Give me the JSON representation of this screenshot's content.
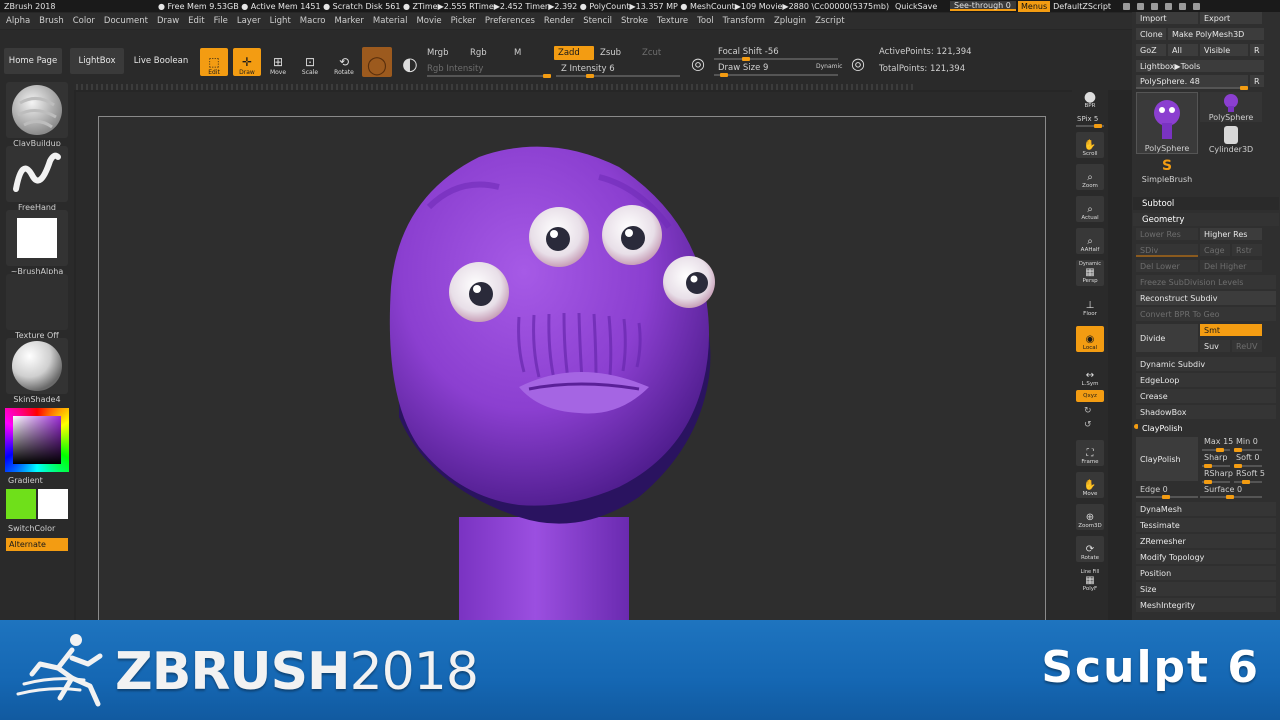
{
  "titlebar": {
    "app": "ZBrush 2018",
    "stats": "● Free Mem 9.53GB ● Active Mem 1451 ● Scratch Disk 561 ● ZTime▶2.555 RTime▶2.452 Timer▶2.392 ● PolyCount▶13.357 MP ● MeshCount▶109 Movie▶2880 \\Cc00000(5375mb)",
    "quicksave": "QuickSave",
    "see_through": "See-through 0",
    "menus": "Menus",
    "default_script": "DefaultZScript"
  },
  "menubar": [
    "Alpha",
    "Brush",
    "Color",
    "Document",
    "Draw",
    "Edit",
    "File",
    "Layer",
    "Light",
    "Macro",
    "Marker",
    "Material",
    "Movie",
    "Picker",
    "Preferences",
    "Render",
    "Stencil",
    "Stroke",
    "Texture",
    "Tool",
    "Transform",
    "Zplugin",
    "Zscript"
  ],
  "shelf": {
    "home_page": "Home Page",
    "lightbox": "LightBox",
    "live_boolean": "Live Boolean",
    "edit": "Edit",
    "draw": "Draw",
    "move": "Move",
    "scale": "Scale",
    "rotate": "Rotate",
    "mrgb": "Mrgb",
    "rgb": "Rgb",
    "m": "M",
    "rgb_intensity": "Rgb Intensity",
    "zadd": "Zadd",
    "zsub": "Zsub",
    "zcut": "Zcut",
    "z_intensity": "Z Intensity 6",
    "z_intensity_value": 6,
    "focal_shift": "Focal Shift -56",
    "draw_size": "Draw Size 9",
    "dynamic": "Dynamic",
    "active_points": "ActivePoints: 121,394",
    "total_points": "TotalPoints: 121,394"
  },
  "lefttray": {
    "brush": "ClayBuildup",
    "stroke": "FreeHand",
    "alpha": "~BrushAlpha",
    "texture": "Texture Off",
    "material": "SkinShade4",
    "gradient": "Gradient",
    "switch_color": "SwitchColor",
    "alternate": "Alternate"
  },
  "rcol": {
    "bpr": "BPR",
    "spix": "SPix 5",
    "scroll": "Scroll",
    "zoom": "Zoom",
    "actual": "Actual",
    "aahalf": "AAHalf",
    "dynamic": "Dynamic",
    "persp": "Persp",
    "floor": "Floor",
    "local": "Local",
    "lsym": "L.Sym",
    "xyz": "Qxyz",
    "frame": "Frame",
    "move": "Move",
    "zoom3d": "Zoom3D",
    "rotate": "Rotate",
    "linefill": "Line Fill",
    "polyf": "PolyF"
  },
  "rpanel": {
    "import": "Import",
    "export": "Export",
    "clone": "Clone",
    "make_polymesh": "Make PolyMesh3D",
    "goz": "GoZ",
    "all": "All",
    "visible": "Visible",
    "r": "R",
    "lightbox_tools": "Lightbox▶Tools",
    "polysphere_count": "PolySphere. 48",
    "thumb_polysphere": "PolySphere",
    "thumb_polysphere2": "PolySphere",
    "thumb_cylinder": "Cylinder3D",
    "thumb_simplebrush": "SimpleBrush",
    "subtool": "Subtool",
    "geometry": "Geometry",
    "lower_res": "Lower Res",
    "higher_res": "Higher Res",
    "sdiv": "SDiv",
    "cage": "Cage",
    "rstr": "Rstr",
    "del_lower": "Del Lower",
    "del_higher": "Del Higher",
    "freeze": "Freeze SubDivision Levels",
    "reconstruct": "Reconstruct Subdiv",
    "convert_bpr": "Convert BPR To Geo",
    "divide": "Divide",
    "smt": "Smt",
    "suv": "Suv",
    "reuv": "ReUV",
    "dynamic_subdiv": "Dynamic Subdiv",
    "edgeloop": "EdgeLoop",
    "crease": "Crease",
    "shadowbox": "ShadowBox",
    "claypolish_hdr": "ClayPolish",
    "claypolish": "ClayPolish",
    "max": "Max 15",
    "min": "Min 0",
    "sharp": "Sharp",
    "soft": "Soft 0",
    "rsharp": "RSharp",
    "rsoft": "RSoft 5",
    "edge": "Edge 0",
    "surface": "Surface 0",
    "dynamesh": "DynaMesh",
    "tessimate": "Tessimate",
    "zremesher": "ZRemesher",
    "modify_topology": "Modify Topology",
    "position": "Position",
    "size": "Size",
    "meshintegrity": "MeshIntegrity"
  },
  "banner": {
    "brand": "ZBRUSH",
    "year": "2018",
    "episode": "Sculpt 6"
  },
  "colors": {
    "accent": "#f39c12",
    "banner_blue": "#1a6db8",
    "model_purple": "#8e3fd1"
  }
}
